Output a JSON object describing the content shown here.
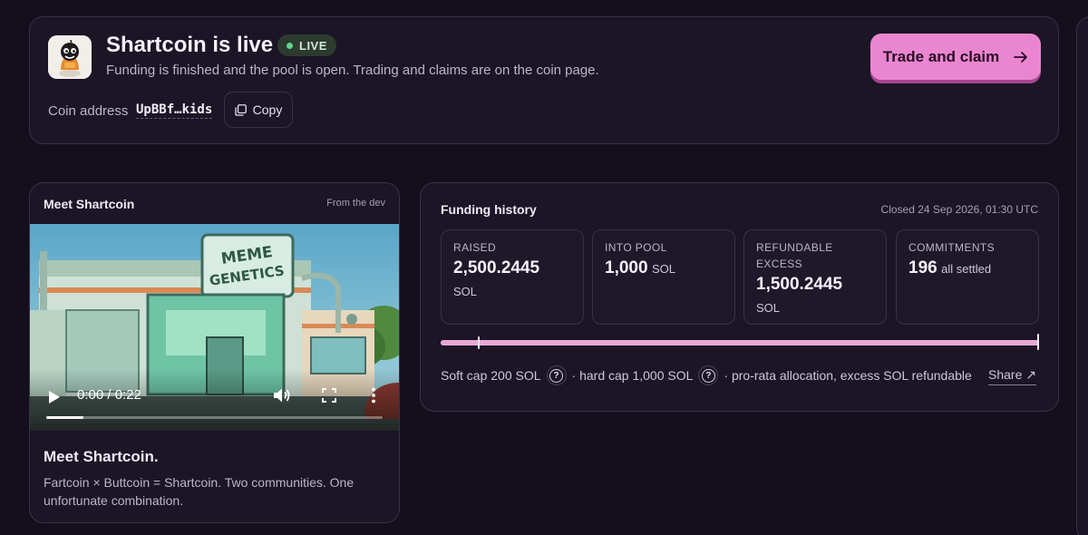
{
  "header": {
    "title": "Shartcoin is live",
    "live_label": "LIVE",
    "subtitle": "Funding is finished and the pool is open. Trading and claims are on the coin page.",
    "address_label": "Coin address",
    "address_value": "UpBBf…kids",
    "copy_label": "Copy",
    "trade_label": "Trade and claim",
    "trade_icon": "arrow-right-icon",
    "accent_color": "#ea86d0",
    "live_color": "#5fd48a"
  },
  "video_card": {
    "title": "Meet Shartcoin",
    "from": "From the dev",
    "time": "0:00 / 0:22",
    "progress": 0.11,
    "heading": "Meet Shartcoin.",
    "description": "Fartcoin × Buttcoin = Shartcoin. Two communities. One unfortunate combination.",
    "sign_line1": "MEME",
    "sign_line2": "GENETICS"
  },
  "funding": {
    "title": "Funding history",
    "closed": "Closed 24 Sep 2026, 01:30 UTC",
    "stats": [
      {
        "label": "RAISED",
        "value": "2,500.2445",
        "unit": "SOL"
      },
      {
        "label": "INTO POOL",
        "value": "1,000",
        "unit": "SOL"
      },
      {
        "label": "REFUNDABLE EXCESS",
        "value": "1,500.2445",
        "unit": "SOL"
      },
      {
        "label": "COMMITMENTS",
        "value": "196",
        "unit": "all settled"
      }
    ],
    "bar_fill": 1.0,
    "soft_cap_position": 0.064,
    "hard_cap_position": 1.0,
    "soft_cap_text": "Soft cap 200 SOL",
    "hard_cap_text": "· hard cap 1,000 SOL",
    "allocation_text": "· pro-rata allocation, excess SOL refundable",
    "share_label": "Share ↗"
  }
}
